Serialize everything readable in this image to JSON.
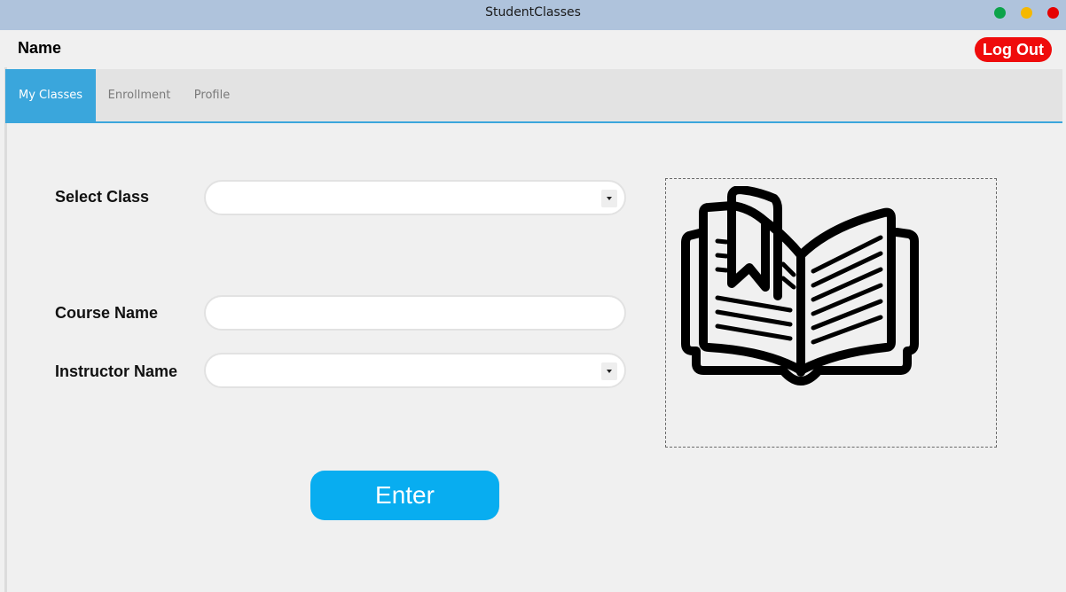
{
  "window": {
    "title": "StudentClasses",
    "controls": [
      "maximize",
      "minimize",
      "close"
    ]
  },
  "header": {
    "user_name": "Name",
    "logout_label": "Log Out"
  },
  "tabs": [
    {
      "label": "My Classes",
      "active": true
    },
    {
      "label": "Enrollment",
      "active": false
    },
    {
      "label": "Profile",
      "active": false
    }
  ],
  "form": {
    "select_class": {
      "label": "Select Class",
      "value": ""
    },
    "course_name": {
      "label": "Course Name",
      "value": ""
    },
    "instructor_name": {
      "label": "Instructor Name",
      "value": ""
    },
    "enter_label": "Enter"
  },
  "image": {
    "icon": "open-book-icon"
  },
  "colors": {
    "titlebar": "#afc3dc",
    "accent": "#3aa6dc",
    "logout": "#ef0b0b",
    "enter": "#08adf0"
  }
}
